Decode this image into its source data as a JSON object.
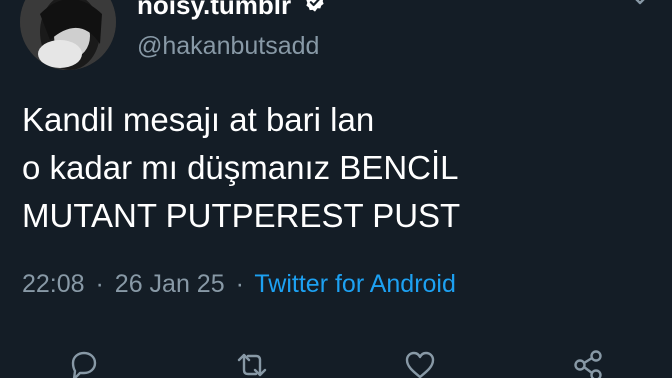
{
  "tweet": {
    "display_name": "noisy.tumblr",
    "handle": "@hakanbutsadd",
    "lines": [
      "Kandil mesajı at bari lan",
      "o kadar mı düşmanız BENCİL",
      "MUTANT PUTPEREST PUST"
    ],
    "time": "22:08",
    "separator": "·",
    "date": "26 Jan 25",
    "source": "Twitter for Android"
  },
  "icons": {
    "avatar": "profile-photo",
    "verified": "verified-badge-icon",
    "menu": "chevron-down-icon",
    "reply": "reply-icon",
    "retweet": "retweet-icon",
    "like": "heart-icon",
    "share": "share-icon"
  },
  "colors": {
    "background": "#141d26",
    "secondary_text": "#8899a6",
    "link": "#1da1f2"
  }
}
